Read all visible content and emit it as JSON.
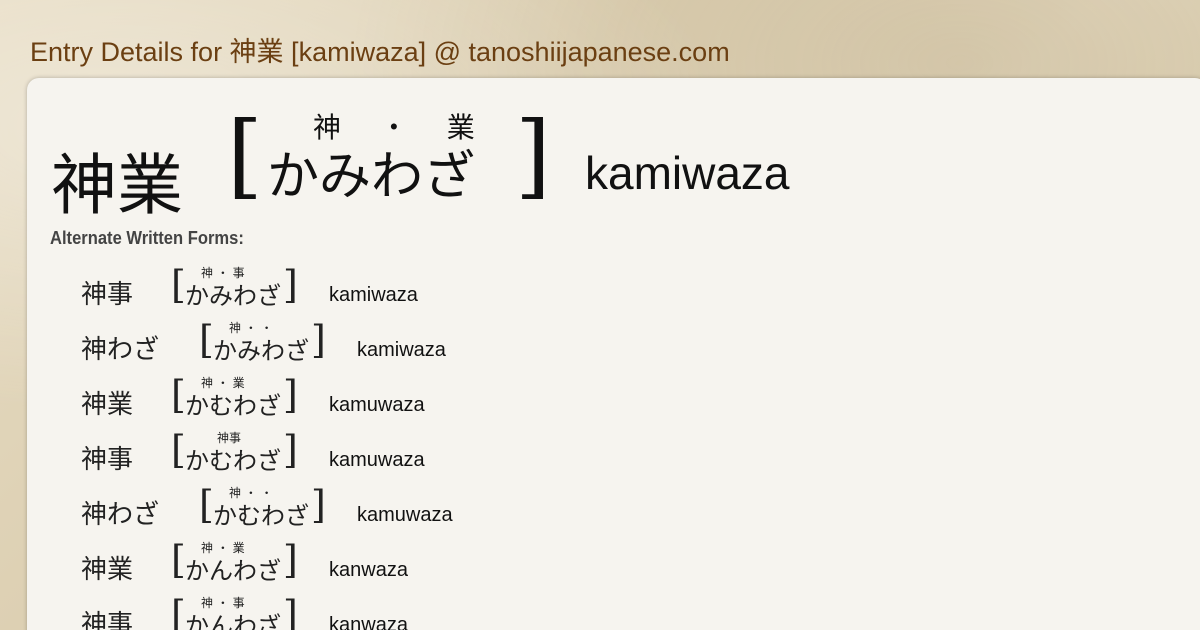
{
  "page_title": "Entry Details for 神業 [kamiwaza] @ tanoshiijapanese.com",
  "main_entry": {
    "kanji": "神業",
    "bracket_open": "[",
    "bracket_close": "]",
    "reading": "かみわざ",
    "furigana": [
      "神",
      "・",
      "業"
    ],
    "romaji": "kamiwaza"
  },
  "alternate_forms": {
    "heading": "Alternate Written Forms:",
    "items": [
      {
        "kanji": "神事",
        "reading": "かみわざ",
        "furigana": "神 ・ 事",
        "romaji": "kamiwaza"
      },
      {
        "kanji": "神わざ",
        "reading": "かみわざ",
        "furigana": "神 ・ ・",
        "romaji": "kamiwaza"
      },
      {
        "kanji": "神業",
        "reading": "かむわざ",
        "furigana": "神 ・ 業",
        "romaji": "kamuwaza"
      },
      {
        "kanji": "神事",
        "reading": "かむわざ",
        "furigana": "神事",
        "romaji": "kamuwaza"
      },
      {
        "kanji": "神わざ",
        "reading": "かむわざ",
        "furigana": "神 ・ ・",
        "romaji": "kamuwaza"
      },
      {
        "kanji": "神業",
        "reading": "かんわざ",
        "furigana": "神 ・ 業",
        "romaji": "kanwaza"
      },
      {
        "kanji": "神事",
        "reading": "かんわざ",
        "furigana": "神 ・ 事",
        "romaji": "kanwaza"
      }
    ]
  }
}
